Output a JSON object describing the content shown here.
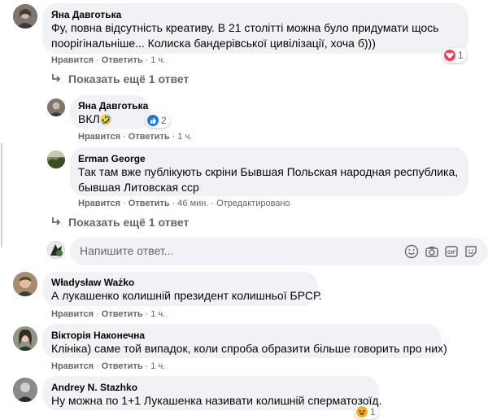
{
  "comments": [
    {
      "author": "Яна Давготька",
      "line1": "Фу, повна відсутність креативу. В 21 столітті можна було придумати щось",
      "line2": "поорігінальніше... Колиска бандерівської цивілізації, хоча б)))",
      "like": "Нравится",
      "reply": "Ответить",
      "time": "1 ч.",
      "reaction_count": "1"
    },
    {
      "author": "Яна Давготька",
      "text": "ВКЛ",
      "emoji": "🤣",
      "like": "Нравится",
      "reply": "Ответить",
      "time": "1 ч.",
      "reaction_count": "2"
    },
    {
      "author": "Erman George",
      "line1": "Так там вже публікують скріни Бывшая Польская народная республика,",
      "line2": "бывшая Литовская сср",
      "like": "Нравится",
      "reply": "Ответить",
      "time": "46 мин.",
      "edited": "Отредактировано"
    },
    {
      "author": "Władysław Ważko",
      "text": "А лукашенко колишній президент колишньої БРСР.",
      "like": "Нравится",
      "reply": "Ответить",
      "time": "1 ч."
    },
    {
      "author": "Вікторія Наконечна",
      "text": "Клініка) саме той випадок, коли спроба образити більше говорить про них)",
      "like": "Нравится",
      "reply": "Ответить",
      "time": "1 ч."
    },
    {
      "author": "Andrey N. Stazhko",
      "text": "Ну можна по 1+1 Лукашенка називати колишній сперматозоїд.",
      "reaction_count": "1"
    }
  ],
  "more_replies_1": "Показать ещё 1 ответ",
  "more_replies_2": "Показать ещё 1 ответ",
  "reply_input": {
    "placeholder": "Напишите ответ..."
  },
  "colors": {
    "bubble": "#f0f2f5",
    "meta": "#65676b",
    "like_blue": "#1877f2",
    "love_red": "#f33e58"
  }
}
